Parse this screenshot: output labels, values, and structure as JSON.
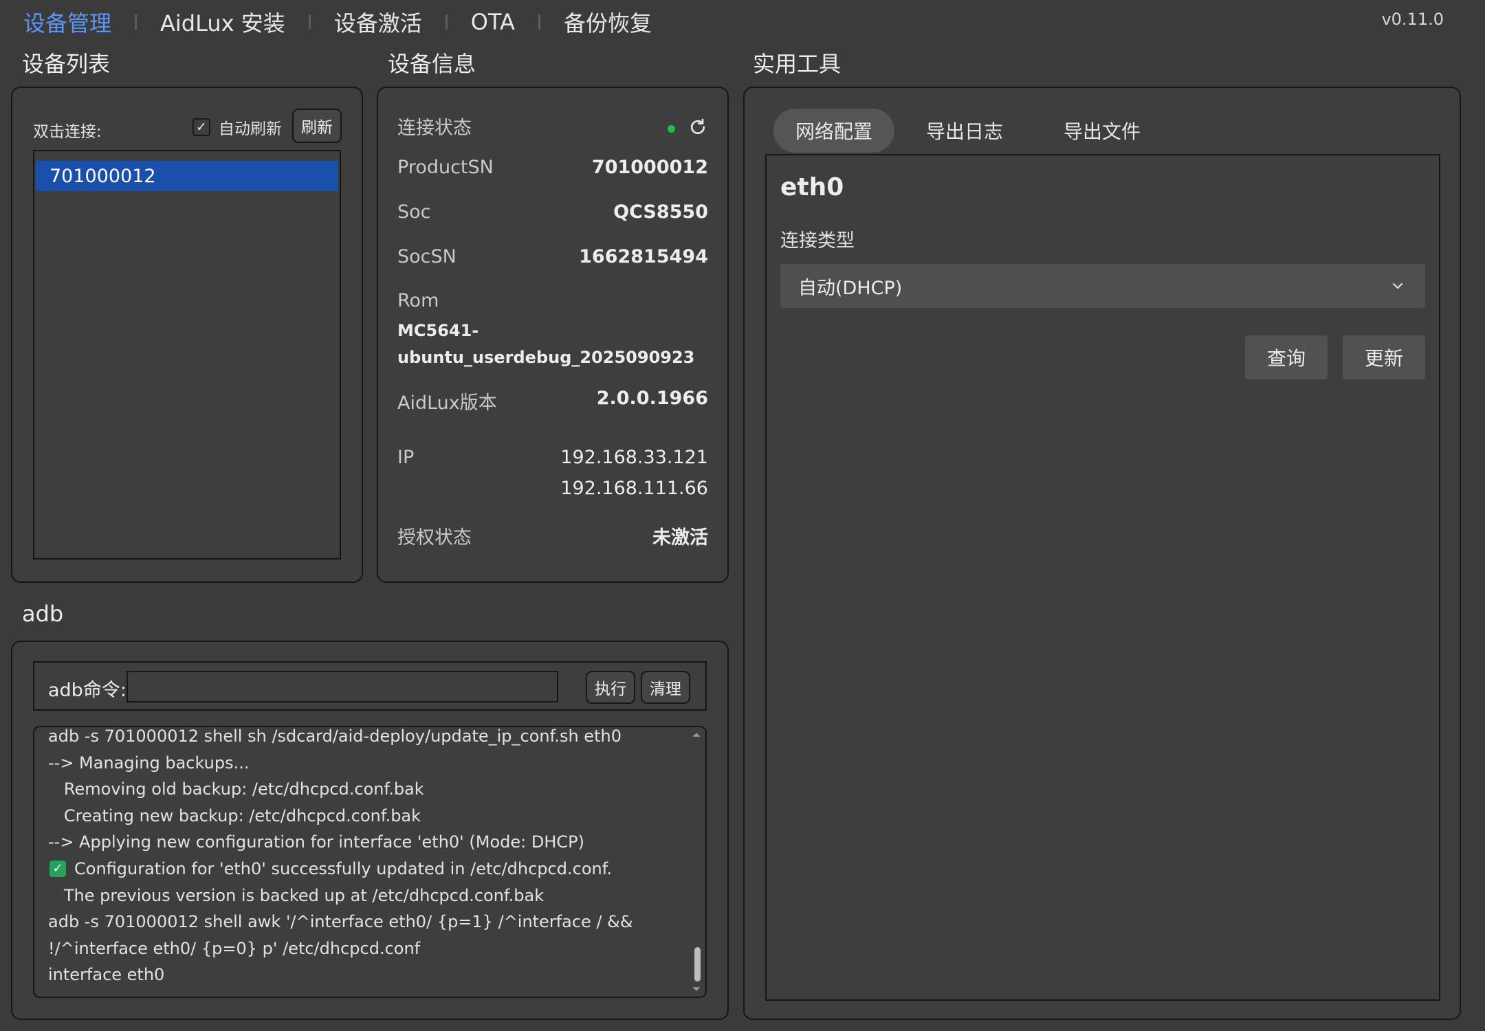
{
  "nav": {
    "items": [
      "设备管理",
      "AidLux 安装",
      "设备激活",
      "OTA",
      "备份恢复"
    ],
    "active_index": 0,
    "version": "v0.11.0"
  },
  "sections": {
    "device_list": "设备列表",
    "device_info": "设备信息",
    "tools": "实用工具",
    "adb": "adb"
  },
  "device_list": {
    "connect_hint": "双击连接:",
    "auto_refresh_label": "自动刷新",
    "auto_refresh_checked": true,
    "refresh_button": "刷新",
    "devices": [
      "701000012"
    ],
    "selected_index": 0
  },
  "device_info": {
    "connection_label": "连接状态",
    "connection_status_color": "#1fbf4a",
    "product_sn_label": "ProductSN",
    "product_sn": "701000012",
    "soc_label": "Soc",
    "soc": "QCS8550",
    "soc_sn_label": "SocSN",
    "soc_sn": "1662815494",
    "rom_label": "Rom",
    "rom_line1": "MC5641-",
    "rom_line2": "ubuntu_userdebug_2025090923",
    "aidlux_version_label": "AidLux版本",
    "aidlux_version": "2.0.0.1966",
    "ip_label": "IP",
    "ip_1": "192.168.33.121",
    "ip_2": "192.168.111.66",
    "license_label": "授权状态",
    "license_status": "未激活"
  },
  "adb": {
    "command_label": "adb命令:",
    "command_value": "",
    "run_button": "执行",
    "clear_button": "清理",
    "output_lines": [
      "adb -s 701000012 shell sh /sdcard/aid-deploy/update_ip_conf.sh eth0",
      "--> Managing backups...",
      "   Removing old backup: /etc/dhcpcd.conf.bak",
      "   Creating new backup: /etc/dhcpcd.conf.bak",
      "--> Applying new configuration for interface 'eth0' (Mode: DHCP)",
      "Configuration for 'eth0' successfully updated in /etc/dhcpcd.conf.",
      "   The previous version is backed up at /etc/dhcpcd.conf.bak",
      "adb -s 701000012 shell awk '/^interface eth0/ {p=1} /^interface / &&",
      "!/^interface eth0/ {p=0} p' /etc/dhcpcd.conf",
      "interface eth0"
    ]
  },
  "tools": {
    "tabs": [
      "网络配置",
      "导出日志",
      "导出文件"
    ],
    "active_tab": 0,
    "interface_name": "eth0",
    "connection_type_label": "连接类型",
    "connection_type_value": "自动(DHCP)",
    "query_button": "查询",
    "update_button": "更新"
  }
}
